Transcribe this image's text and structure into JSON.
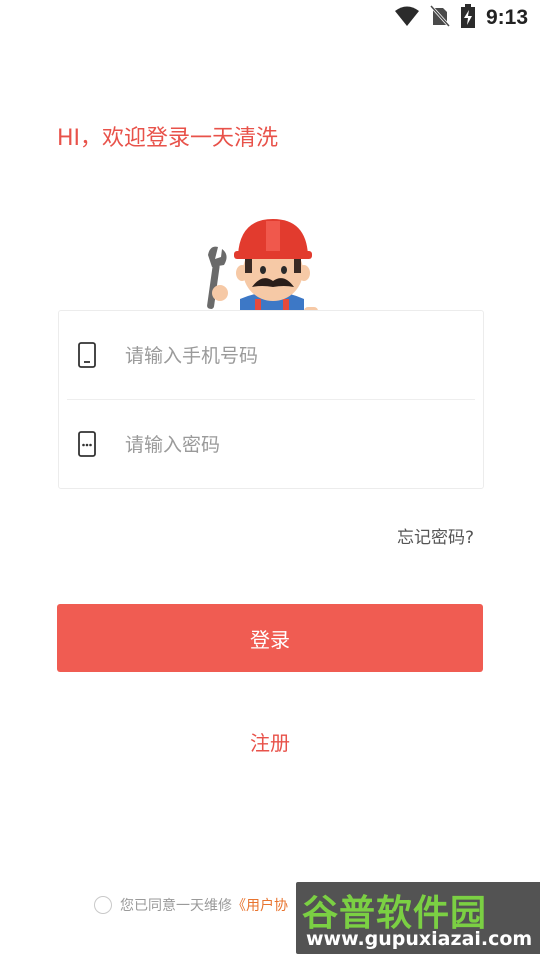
{
  "status_bar": {
    "time": "9:13",
    "icons": [
      "wifi-icon",
      "no-sim-icon",
      "battery-charging-icon"
    ]
  },
  "login": {
    "greeting": "HI，欢迎登录一天清洗",
    "phone_placeholder": "请输入手机号码",
    "password_placeholder": "请输入密码",
    "forgot_password": "忘记密码?",
    "login_button": "登录",
    "register_link": "注册",
    "agreement_text": "您已同意一天维修",
    "agreement_link": "《用户协"
  },
  "watermark": {
    "title": "谷普软件园",
    "url": "www.gupuxiazai.com"
  },
  "colors": {
    "accent": "#f05c52",
    "greeting": "#e8524a",
    "link": "#e8742f",
    "watermark_green": "#7bd043"
  }
}
